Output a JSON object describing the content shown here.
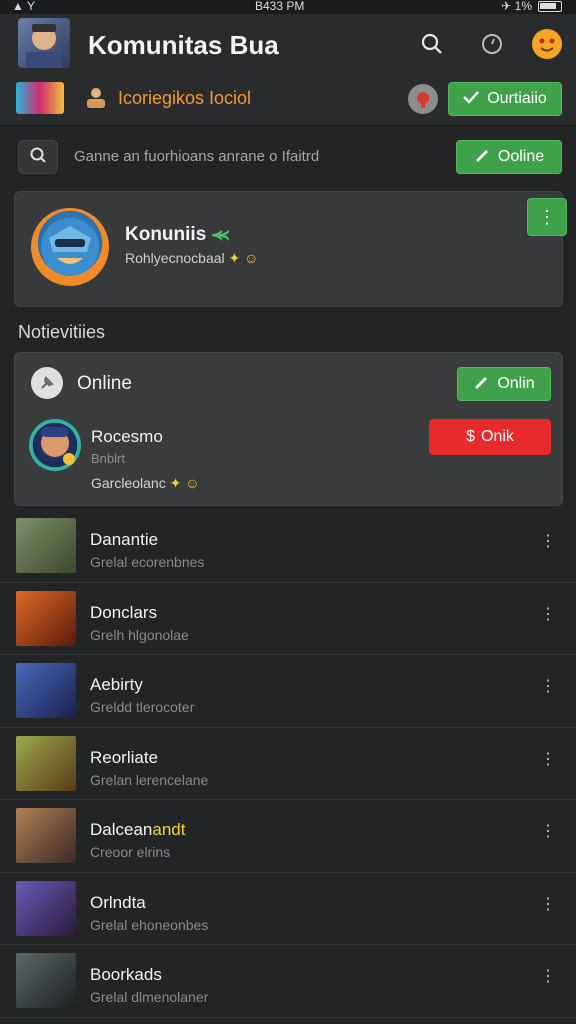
{
  "status": {
    "signal": "▲ Y",
    "time": "B433 PM",
    "right": "✈ 1%"
  },
  "header": {
    "title": "Komunitas Bua"
  },
  "subbar": {
    "label": "Icoriegikos Iociol",
    "button": "Ourtiaiio"
  },
  "search": {
    "placeholder": "Ganne an fuorhioans anrane o Ifaitrd",
    "button": "Ooline"
  },
  "profile": {
    "name": "Konuniis",
    "name_suffix": "⪻",
    "subtitle": "Rohlyecnocbaal",
    "more": "⋮"
  },
  "section_title": "Notievitiies",
  "online_card": {
    "label": "Online",
    "button": "Onlin",
    "member": {
      "name": "Rocesmo",
      "status": "Bnblrt",
      "note": "Garcleolanc"
    },
    "red_button": "Onik"
  },
  "list": [
    {
      "title": "Danantie",
      "subtitle": "Grelal ecorenbnes",
      "thumb": "#5c6b4a"
    },
    {
      "title": "Donclars",
      "subtitle": "Grelh hlgonolae",
      "thumb": "#a3461f"
    },
    {
      "title": "Aebirty",
      "subtitle": "Greldd tlerocoter",
      "thumb": "#3a4a8a"
    },
    {
      "title": "Reorliate",
      "subtitle": "Grelan lerencelane",
      "thumb": "#7a8a3a"
    },
    {
      "title": "Dalcean",
      "title_hl": "andt",
      "subtitle": "Creoor elrins",
      "thumb": "#8a5a3a"
    },
    {
      "title": "Orlndta",
      "subtitle": "Grelal ehoneonbes",
      "thumb": "#5a4a8a"
    },
    {
      "title": "Boorkads",
      "subtitle": "Grelal dlmenolaner",
      "thumb": "#4a5a5a"
    }
  ]
}
